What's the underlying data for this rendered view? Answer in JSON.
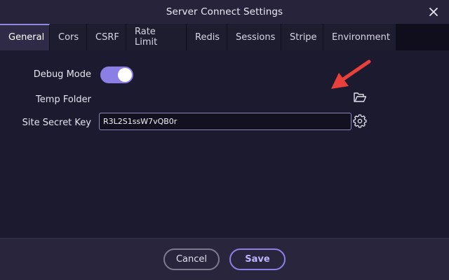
{
  "window": {
    "title": "Server Connect Settings"
  },
  "tabs": [
    {
      "label": "General",
      "active": true
    },
    {
      "label": "Cors",
      "active": false
    },
    {
      "label": "CSRF",
      "active": false
    },
    {
      "label": "Rate Limit",
      "active": false
    },
    {
      "label": "Redis",
      "active": false
    },
    {
      "label": "Sessions",
      "active": false
    },
    {
      "label": "Stripe",
      "active": false
    },
    {
      "label": "Environment",
      "active": false
    }
  ],
  "general": {
    "debug_mode": {
      "label": "Debug Mode",
      "enabled": true
    },
    "temp_folder": {
      "label": "Temp Folder",
      "icon": "folder-open-icon"
    },
    "site_secret_key": {
      "label": "Site Secret Key",
      "value": "R3L2S1ssW7vQB0r",
      "icon": "gear-icon"
    }
  },
  "annotation": {
    "icon": "red-arrow-icon",
    "color": "#e8403a"
  },
  "footer": {
    "cancel_label": "Cancel",
    "save_label": "Save"
  },
  "colors": {
    "accent": "#8b7fe6",
    "background": "#1c1a2e",
    "titlebar": "#26233a"
  }
}
